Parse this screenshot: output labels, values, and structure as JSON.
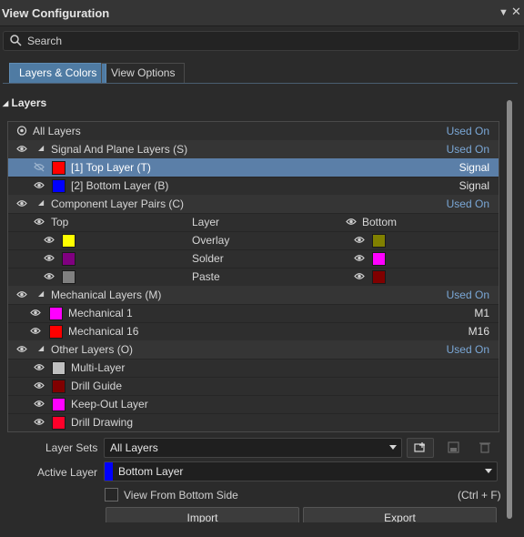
{
  "panel": {
    "title": "View Configuration",
    "pin_icon": "dropdown-icon",
    "close_icon": "close-icon"
  },
  "search": {
    "placeholder": "Search"
  },
  "tabs": [
    {
      "label": "Layers & Colors",
      "active": true
    },
    {
      "label": "View Options",
      "active": false
    }
  ],
  "section": {
    "label": "Layers"
  },
  "tree": {
    "all_layers": {
      "label": "All Layers",
      "used": "Used On"
    },
    "signal_group": {
      "label": "Signal And Plane Layers (S)",
      "used": "Used On"
    },
    "signal_layers": [
      {
        "label": "[1] Top Layer (T)",
        "color": "#ff0000",
        "value": "Signal",
        "selected": true
      },
      {
        "label": "[2] Bottom Layer (B)",
        "color": "#0000ff",
        "value": "Signal",
        "selected": false
      }
    ],
    "component_group": {
      "label": "Component Layer Pairs (C)",
      "used": "Used On"
    },
    "pair_header": {
      "top": "Top",
      "layer": "Layer",
      "bottom": "Bottom"
    },
    "pairs": [
      {
        "name": "Overlay",
        "top_color": "#ffff00",
        "bottom_color": "#808000"
      },
      {
        "name": "Solder",
        "top_color": "#800080",
        "bottom_color": "#ff00ff"
      },
      {
        "name": "Paste",
        "top_color": "#808080",
        "bottom_color": "#800000"
      }
    ],
    "mech_group": {
      "label": "Mechanical Layers (M)",
      "used": "Used On"
    },
    "mech_layers": [
      {
        "label": "Mechanical 1",
        "color": "#ff00ff",
        "value": "M1"
      },
      {
        "label": "Mechanical 16",
        "color": "#ff0000",
        "value": "M16"
      }
    ],
    "other_group": {
      "label": "Other Layers (O)",
      "used": "Used On"
    },
    "other_layers": [
      {
        "label": "Multi-Layer",
        "color": "#c0c0c0"
      },
      {
        "label": "Drill Guide",
        "color": "#800000"
      },
      {
        "label": "Keep-Out Layer",
        "color": "#ff00ff"
      },
      {
        "label": "Drill Drawing",
        "color": "#ff002a"
      }
    ]
  },
  "layer_sets": {
    "label": "Layer Sets",
    "value": "All Layers"
  },
  "active_layer": {
    "label": "Active Layer",
    "value": "Bottom Layer",
    "color": "#0000ff"
  },
  "view_bottom": {
    "label": "View From Bottom Side",
    "shortcut": "(Ctrl + F)"
  },
  "buttons": {
    "import": "Import",
    "export": "Export"
  }
}
